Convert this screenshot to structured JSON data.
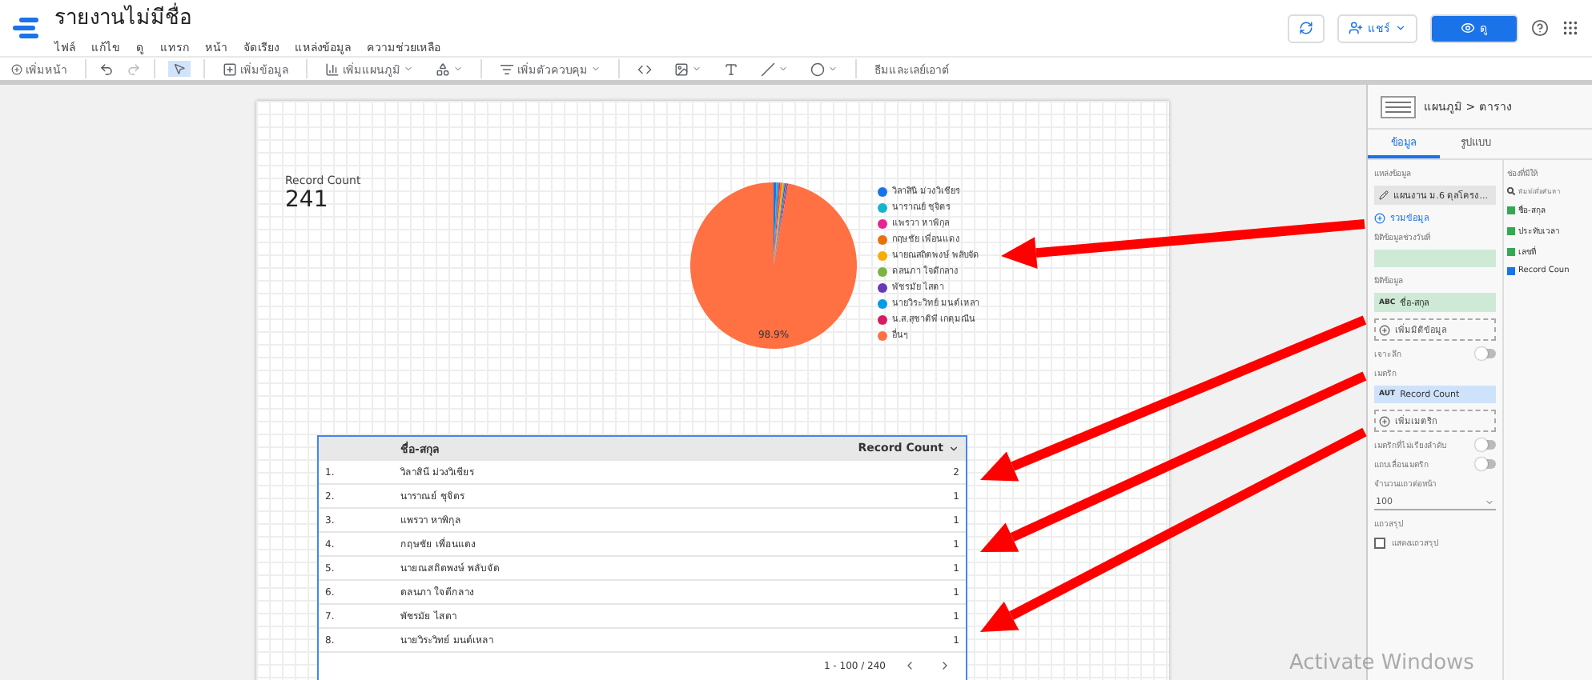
{
  "header": {
    "title": "รายงานไม่มีชื่อ",
    "menu": [
      "ไฟล์",
      "แก้ไข",
      "ดู",
      "แทรก",
      "หน้า",
      "จัดเรียง",
      "แหล่งข้อมูล",
      "ความช่วยเหลือ"
    ],
    "share_label": "แชร์",
    "view_label": "ดู"
  },
  "toolbar": {
    "add_page": "เพิ่มหน้า",
    "add_data": "เพิ่มข้อมูล",
    "add_chart": "เพิ่มแผนภูมิ",
    "add_control": "เพิ่มตัวควบคุม",
    "theme": "ธีมและเลย์เอาต์"
  },
  "scorecard": {
    "label": "Record Count",
    "value": "241"
  },
  "pie": {
    "slice_label": "98.9%",
    "legend": [
      {
        "label": "วิลาสินี ม่วงวิเชียร",
        "color": "#1a73e8"
      },
      {
        "label": "นาราณย์ ชุจิตร",
        "color": "#12b5cb"
      },
      {
        "label": "แพรวา หาพิกุล",
        "color": "#e52592"
      },
      {
        "label": "กฤษชัย เพื่อนแดง",
        "color": "#e8710a"
      },
      {
        "label": "นายณสถิตพงษ์ พลับจัด",
        "color": "#f9ab00"
      },
      {
        "label": "ดลนภา ใจดีกลาง",
        "color": "#7cb342"
      },
      {
        "label": "พัชรมัย ไสตา",
        "color": "#673ab7"
      },
      {
        "label": "นายวิระวิทย์ มนต์เหลา",
        "color": "#039be5"
      },
      {
        "label": "น.ส.สุชาติพี เกตุมณีน",
        "color": "#d81b60"
      },
      {
        "label": "อื่นๆ",
        "color": "#ff7043"
      }
    ]
  },
  "table": {
    "columns": [
      "ชื่อ-สกุล",
      "Record Count"
    ],
    "rows": [
      {
        "index": "1.",
        "name": "วิลาสินี ม่วงวิเชียร",
        "count": "2"
      },
      {
        "index": "2.",
        "name": "นาราณย์ ชุจิตร",
        "count": "1"
      },
      {
        "index": "3.",
        "name": "แพรวา หาพิกุล",
        "count": "1"
      },
      {
        "index": "4.",
        "name": "กฤษชัย เพื่อนแดง",
        "count": "1"
      },
      {
        "index": "5.",
        "name": "นายณสถิตพงษ์ พลับจัด",
        "count": "1"
      },
      {
        "index": "6.",
        "name": "ดลนภา ใจดีกลาง",
        "count": "1"
      },
      {
        "index": "7.",
        "name": "พัชรมัย ไสตา",
        "count": "1"
      },
      {
        "index": "8.",
        "name": "นายวิระวิทย์ มนต์เหลา",
        "count": "1"
      }
    ],
    "pagination": "1 - 100 / 240"
  },
  "panel": {
    "breadcrumb": "แผนภูมิ > ตาราง",
    "tabs": [
      {
        "label": "ข้อมูล",
        "selected": true
      },
      {
        "label": "รูปแบบ",
        "selected": false
      }
    ],
    "source_heading": "แหล่งข้อมูล",
    "source": "แผนงาน ม.6 ดุลโครง...",
    "blend": "รวมข้อมูล",
    "date_heading": "มิติข้อมูลช่วงวันที่",
    "dimension_heading": "มิติข้อมูล",
    "dimension_type": "ABC",
    "dimension": "ชื่อ-สกุล",
    "add_dimension": "เพิ่มมิติข้อมูล",
    "drill": {
      "label": "เจาะลึก",
      "on": false
    },
    "metric_heading": "เมตริก",
    "metric_type": "AUT",
    "metric": "Record Count",
    "add_metric": "เพิ่มเมตริก",
    "toggles": [
      {
        "label": "เมตริกที่ไม่เรียงลำดับ",
        "on": false
      },
      {
        "label": "แถบเลื่อนเมตริก",
        "on": false
      }
    ],
    "rows_heading": "จำนวนแถวต่อหน้า",
    "rows_value": "100",
    "summary_heading": "แถวสรุป",
    "summary": {
      "label": "แสดงแถวสรุป",
      "checked": false
    },
    "fields_heading": "ช่องที่มีให้",
    "search_placeholder": "พิมพ์เพื่อค้นหา",
    "fields": [
      {
        "label": "ชื่อ-สกุล",
        "kind": "text"
      },
      {
        "label": "ประทับเวลา",
        "kind": "date"
      },
      {
        "label": "เลขที่",
        "kind": "text"
      },
      {
        "label": "Record Coun",
        "kind": "number"
      }
    ]
  },
  "os_notice": "Activate Windows"
}
